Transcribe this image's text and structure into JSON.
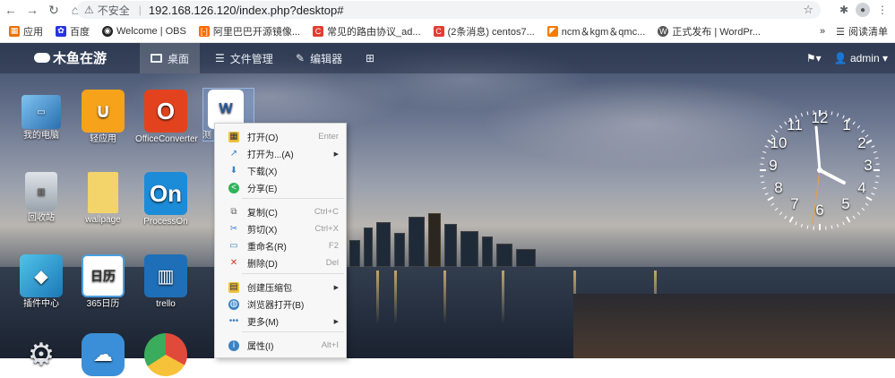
{
  "browser": {
    "security_label": "不安全",
    "url": "192.168.126.120/index.php?desktop#",
    "bookmarks": [
      "应用",
      "百度",
      "Welcome | OBS",
      "阿里巴巴开源镜像...",
      "常见的路由协议_ad...",
      "(2条消息) centos7...",
      "ncm＆kgm＆qmc...",
      "正式发布 | WordPr..."
    ],
    "more_label": "»",
    "reading_list": "阅读清单"
  },
  "app": {
    "logo_text": "木鱼在游",
    "tabs": [
      "桌面",
      "文件管理",
      "编辑器",
      ""
    ],
    "user": "admin"
  },
  "desktop": {
    "icons": [
      {
        "label": "我的电脑"
      },
      {
        "label": "轻应用"
      },
      {
        "label": "OfficeConverter"
      },
      {
        "label": "测"
      },
      {
        "label": "回收站"
      },
      {
        "label": "wallpage"
      },
      {
        "label": "ProcessOn"
      },
      {
        "label": "插件中心"
      },
      {
        "label": "365日历"
      },
      {
        "label": "trello"
      }
    ]
  },
  "clock": {
    "numbers": [
      "12",
      "1",
      "2",
      "3",
      "4",
      "5",
      "6",
      "7",
      "8",
      "9",
      "10",
      "11"
    ]
  },
  "context_menu": {
    "items": [
      {
        "label": "打开(O)",
        "shortcut": "Enter"
      },
      {
        "label": "打开为...(A)",
        "shortcut": ""
      },
      {
        "label": "下载(X)",
        "shortcut": ""
      },
      {
        "label": "分享(E)",
        "shortcut": ""
      },
      {
        "label": "复制(C)",
        "shortcut": "Ctrl+C"
      },
      {
        "label": "剪切(X)",
        "shortcut": "Ctrl+X"
      },
      {
        "label": "重命名(R)",
        "shortcut": "F2"
      },
      {
        "label": "删除(D)",
        "shortcut": "Del"
      },
      {
        "label": "创建压缩包",
        "shortcut": ""
      },
      {
        "label": "浏览器打开(B)",
        "shortcut": ""
      },
      {
        "label": "更多(M)",
        "shortcut": ""
      },
      {
        "label": "属性(I)",
        "shortcut": "Alt+I"
      }
    ]
  },
  "colors": {
    "accent": "#3b82c4",
    "danger": "#d93025",
    "office_red": "#e2431e",
    "processon_blue": "#1c8bd8"
  }
}
